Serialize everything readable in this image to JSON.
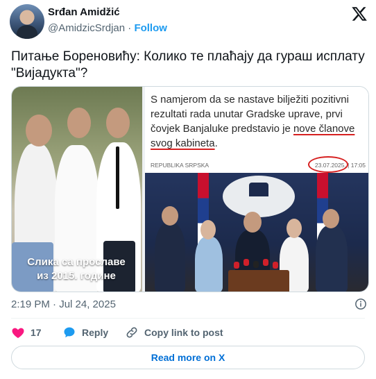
{
  "author": {
    "name": "Srđan Amidžić",
    "handle": "@AmidzicSrdjan",
    "separator": "·",
    "follow_label": "Follow"
  },
  "tweet": {
    "text": "Питање Бореновићу: Колико те плаћају да гураш исплату \"Вијадукта\"?"
  },
  "media": {
    "left_caption_line1": "Слика са прославе",
    "left_caption_line2": "из 2015. године",
    "article_text_before": "S namjerom da se nastave bilježiti pozitivni rezultati rada unutar Gradske uprave, prvi čovjek Banjaluke predstavio je ",
    "article_text_highlight": "nove članove svog kabineta",
    "article_text_after": ".",
    "source_label": "REPUBLIKA SRPSKA",
    "article_date": "23.07.2025. | 17:05"
  },
  "timestamp": "2:19 PM · Jul 24, 2025",
  "actions": {
    "likes_count": "17",
    "reply_label": "Reply",
    "copy_link_label": "Copy link to post"
  },
  "read_more_label": "Read more on X",
  "colors": {
    "accent": "#1d9bf0",
    "like": "#f91880",
    "link": "#006fd6",
    "muted": "#536471",
    "annotation_red": "#d62020"
  },
  "icons": [
    "x-logo-icon",
    "info-icon",
    "heart-icon",
    "reply-bubble-icon",
    "link-icon"
  ]
}
